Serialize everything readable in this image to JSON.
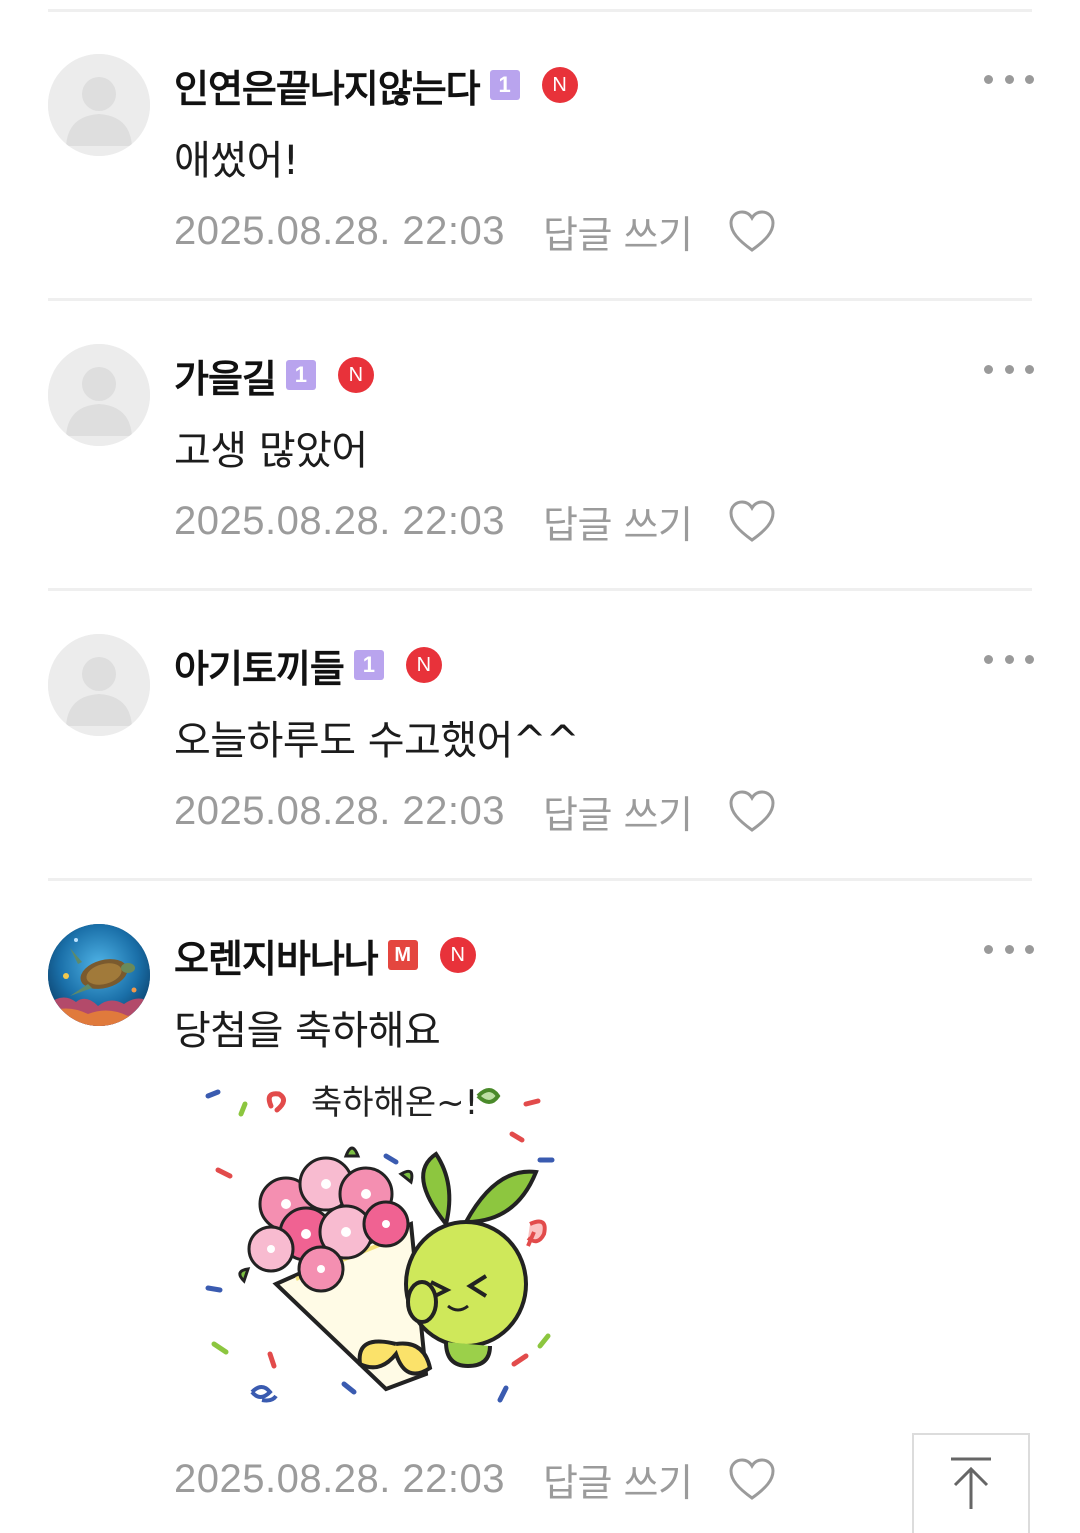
{
  "comments": [
    {
      "name": "인연은끝나지않는다",
      "level_badge": "1",
      "new_badge": "N",
      "text": "애썼어!",
      "date": "2025.08.28. 22:03",
      "reply_label": "답글 쓰기"
    },
    {
      "name": "가을길",
      "level_badge": "1",
      "new_badge": "N",
      "text": "고생 많았어",
      "date": "2025.08.28. 22:03",
      "reply_label": "답글 쓰기"
    },
    {
      "name": "아기토끼들",
      "level_badge": "1",
      "new_badge": "N",
      "text": "오늘하루도 수고했어^^",
      "date": "2025.08.28. 22:03",
      "reply_label": "답글 쓰기"
    },
    {
      "name": "오렌지바나나",
      "level_badge": "M",
      "new_badge": "N",
      "text": "당첨을 축하해요",
      "date": "2025.08.28. 22:03",
      "reply_label": "답글 쓰기"
    }
  ],
  "sticker": {
    "caption": "축하해온~!"
  },
  "icons": {
    "more": "more-options-icon",
    "like": "heart-outline-icon",
    "scroll_top": "arrow-up-to-top-icon",
    "default_avatar": "default-profile-icon"
  },
  "colors": {
    "level_badge": "#b9a4ee",
    "manager_badge": "#e4463f",
    "new_badge": "#e8323a",
    "meta_text": "#9b9b9b"
  }
}
